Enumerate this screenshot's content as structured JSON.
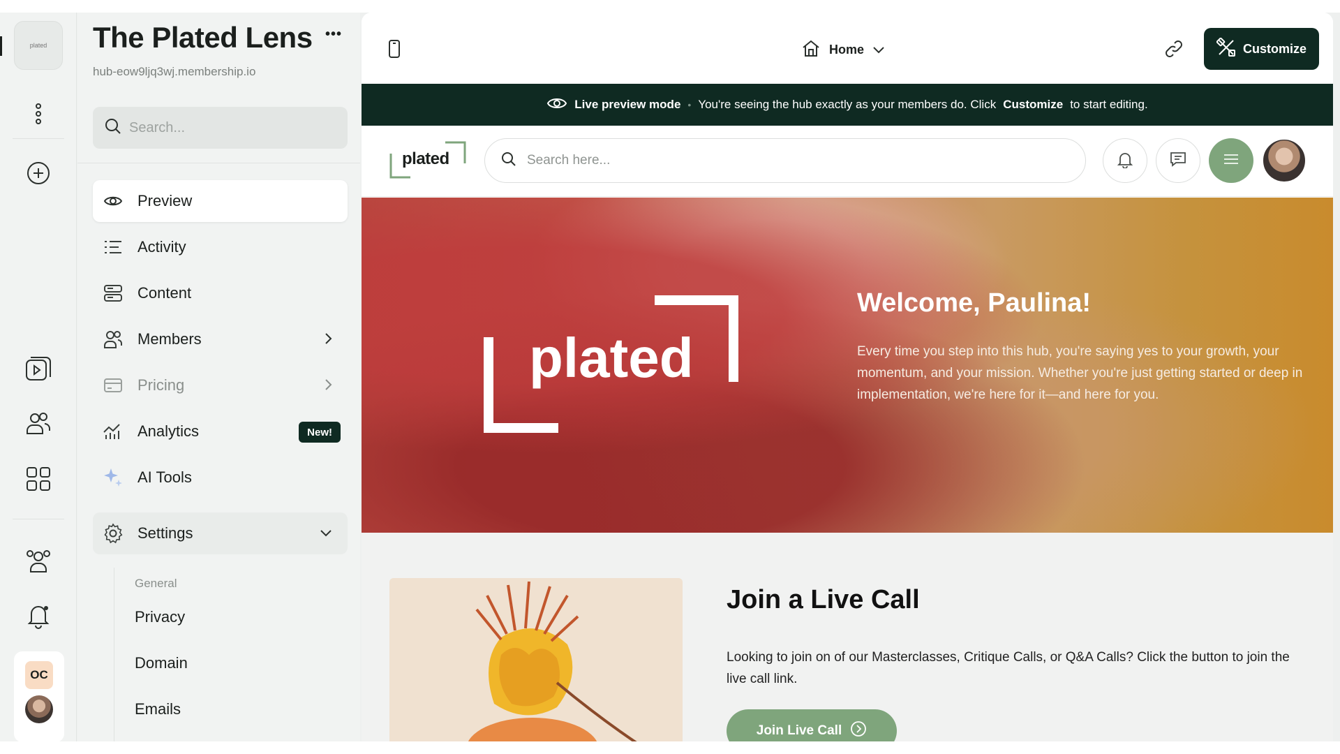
{
  "rail": {
    "logo_text": "plated",
    "user_initials": "OC"
  },
  "sidebar": {
    "hub_title": "The Plated Lens",
    "hub_more": "•••",
    "hub_url": "hub-eow9ljq3wj.membership.io",
    "search_placeholder": "Search...",
    "items": [
      {
        "label": "Preview",
        "icon": "eye-icon"
      },
      {
        "label": "Activity",
        "icon": "list-icon"
      },
      {
        "label": "Content",
        "icon": "content-icon"
      },
      {
        "label": "Members",
        "icon": "users-icon"
      },
      {
        "label": "Pricing",
        "icon": "card-icon"
      },
      {
        "label": "Analytics",
        "icon": "chart-icon",
        "badge": "New!"
      },
      {
        "label": "AI Tools",
        "icon": "sparkle-icon"
      },
      {
        "label": "Settings",
        "icon": "gear-icon"
      }
    ],
    "settings_sub": {
      "heading": "General",
      "items": [
        "Privacy",
        "Domain",
        "Emails"
      ]
    }
  },
  "topbar": {
    "page_select": "Home",
    "customize_label": "Customize"
  },
  "banner": {
    "mode": "Live preview mode",
    "dot": "•",
    "text_before": "You're seeing the hub exactly as your members do. Click",
    "bold_word": "Customize",
    "text_after": "to start editing."
  },
  "preview": {
    "logo_text": "plated",
    "search_placeholder": "Search here...",
    "hero": {
      "logo_text": "plated",
      "title": "Welcome, Paulina!",
      "text": "Every time you step into this hub, you're saying yes to your growth, your momentum, and your mission. Whether you're just getting started or deep in implementation, we're here for it—and here for you."
    },
    "section": {
      "title": "Join a Live Call",
      "text": "Looking to join on of our Masterclasses, Critique Calls, or Q&A Calls? Click the button to join the live call link.",
      "button_label": "Join Live Call"
    }
  },
  "colors": {
    "brand_dark": "#0f2a22",
    "brand_green": "#7fa57c",
    "accent_orange": "#f9dcc4"
  }
}
